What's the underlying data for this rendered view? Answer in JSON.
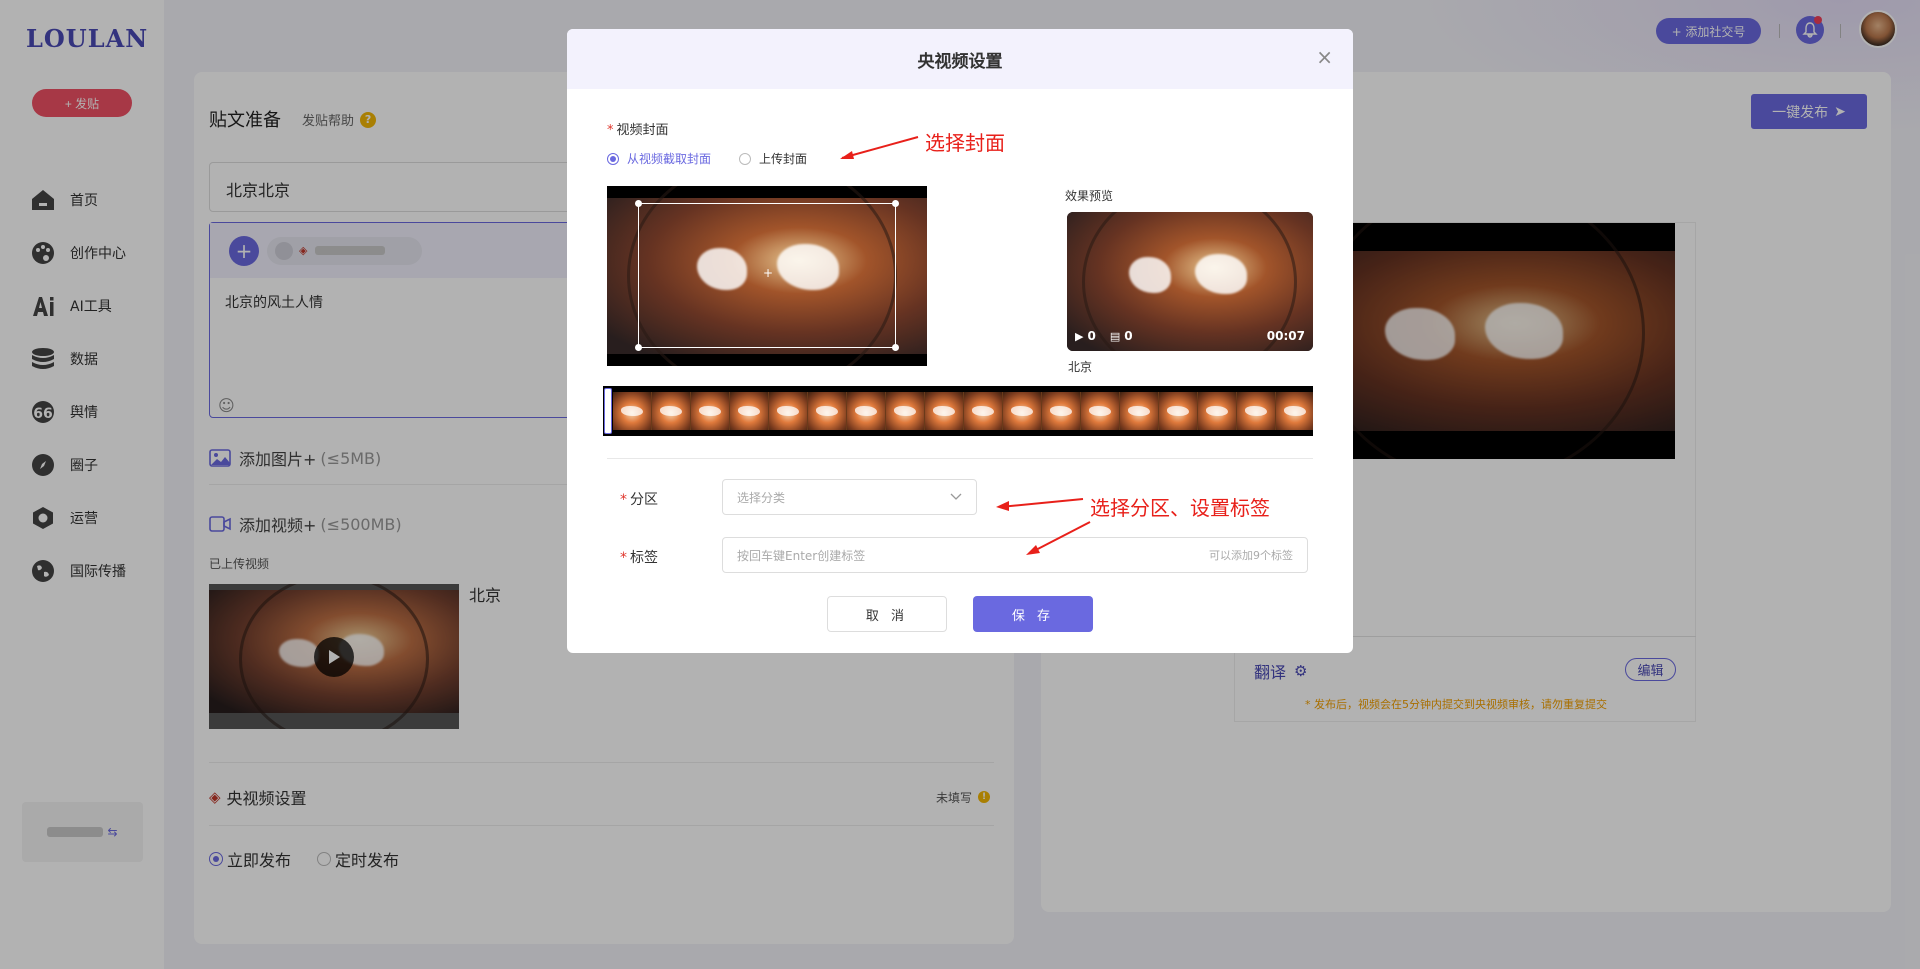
{
  "brand": {
    "logo": "LOULAN"
  },
  "sidebar": {
    "post_button": "+ 发贴",
    "items": [
      {
        "label": "首页",
        "icon": "home-icon"
      },
      {
        "label": "创作中心",
        "icon": "palette-icon"
      },
      {
        "label": "AI工具",
        "icon": "ai-icon"
      },
      {
        "label": "数据",
        "icon": "database-icon"
      },
      {
        "label": "舆情",
        "icon": "quote-icon"
      },
      {
        "label": "圈子",
        "icon": "compass-icon"
      },
      {
        "label": "运营",
        "icon": "hexagon-icon"
      },
      {
        "label": "国际传播",
        "icon": "globe-icon"
      }
    ]
  },
  "topbar": {
    "add_account": "+ 添加社交号"
  },
  "composer": {
    "title": "贴文准备",
    "help": "发贴帮助",
    "title_value": "北京北京",
    "body_text": "北京的风土人情",
    "add_image": "添加图片+",
    "add_image_hint": "(≤5MB)",
    "add_video": "添加视频+",
    "add_video_hint": "(≤500MB)",
    "uploaded_label": "已上传视频",
    "video_name": "北京",
    "cctv_settings": "央视频设置",
    "cctv_status": "未填写",
    "publish_now": "立即发布",
    "publish_scheduled": "定时发布"
  },
  "preview": {
    "publish_button": "一键发布",
    "translate": "翻译",
    "edit": "编辑",
    "notice": "* 发布后，视频会在5分钟内提交到央视频审核，请勿重复提交"
  },
  "modal": {
    "title": "央视频设置",
    "cover_label": "视频封面",
    "cover_option_capture": "从视频截取封面",
    "cover_option_upload": "上传封面",
    "preview_label": "效果预览",
    "preview_plays": "0",
    "preview_comments": "0",
    "preview_duration": "00:07",
    "preview_name": "北京",
    "category_label": "分区",
    "category_placeholder": "选择分类",
    "tags_label": "标签",
    "tags_placeholder": "按回车键Enter创建标签",
    "tags_hint": "可以添加9个标签",
    "cancel": "取 消",
    "save": "保 存"
  },
  "annotations": {
    "cover": "选择封面",
    "category_tags": "选择分区、设置标签"
  },
  "colors": {
    "brand": "#6a69e0",
    "post_button": "#f05165",
    "annotation": "#e8201a",
    "warning": "#f2b705"
  }
}
